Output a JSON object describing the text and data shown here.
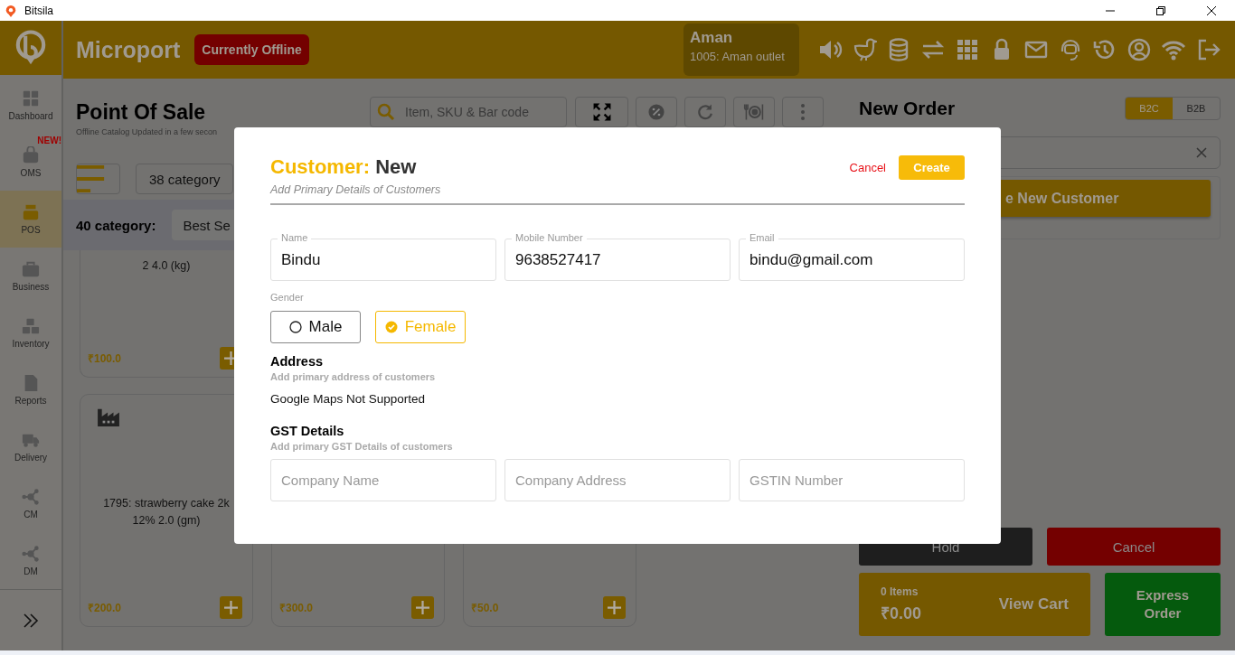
{
  "window": {
    "title": "Bitsila"
  },
  "sidebar": {
    "items": [
      {
        "label": "Dashboard",
        "selected": false
      },
      {
        "label": "OMS",
        "selected": false,
        "badge": "NEW!"
      },
      {
        "label": "POS",
        "selected": true
      },
      {
        "label": "Business",
        "selected": false
      },
      {
        "label": "Inventory",
        "selected": false
      },
      {
        "label": "Reports",
        "selected": false
      },
      {
        "label": "Delivery",
        "selected": false
      },
      {
        "label": "CM",
        "selected": false
      },
      {
        "label": "DM",
        "selected": false
      }
    ]
  },
  "header": {
    "brand": "Microport",
    "status": "Currently Offline",
    "user": {
      "name": "Aman",
      "outlet": "1005: Aman outlet"
    }
  },
  "catalog": {
    "title": "Point Of Sale",
    "subtitle": "Offline Catalog Updated in a few secon",
    "search": {
      "placeholder": "Item, SKU & Bar code"
    },
    "category_filter": "38 category",
    "category_count": "40 category:",
    "category_tab": "Best Se",
    "products": [
      {
        "lines": [
          "2 4.0 (kg)"
        ],
        "price": "₹100.0",
        "kind": "cut"
      },
      {
        "lines": [
          "1795: strawberry cake 2k",
          "12% 2.0 (gm)"
        ],
        "price": "₹200.0",
        "kind": "full"
      },
      {
        "price": "₹300.0",
        "kind": "bare"
      },
      {
        "price": "₹50.0",
        "kind": "bare"
      }
    ]
  },
  "order": {
    "title": "New Order",
    "modes": [
      {
        "label": "B2C",
        "selected": true
      },
      {
        "label": "B2B",
        "selected": false
      }
    ],
    "customer_button": "e New Customer",
    "hold": "Hold",
    "cancel": "Cancel",
    "cart": {
      "items": "0 Items",
      "total": "₹0.00",
      "label": "View Cart"
    },
    "express": "Express Order"
  },
  "dialog": {
    "title_prefix": "Customer:",
    "title": "New",
    "subtitle": "Add Primary Details of Customers",
    "cancel": "Cancel",
    "create": "Create",
    "fields": [
      {
        "label": "Name",
        "value": "Bindu"
      },
      {
        "label": "Mobile Number",
        "value": "9638527417"
      },
      {
        "label": "Email",
        "value": "bindu@gmail.com"
      }
    ],
    "gender": {
      "label": "Gender",
      "options": [
        {
          "label": "Male",
          "selected": false
        },
        {
          "label": "Female",
          "selected": true
        }
      ]
    },
    "address": {
      "title": "Address",
      "subtitle": "Add primary address of customers",
      "note": "Google Maps Not Supported"
    },
    "gst": {
      "title": "GST Details",
      "subtitle": "Add primary GST Details of customers",
      "fields": [
        {
          "placeholder": "Company Name"
        },
        {
          "placeholder": "Company Address"
        },
        {
          "placeholder": "GSTIN Number"
        }
      ]
    }
  }
}
